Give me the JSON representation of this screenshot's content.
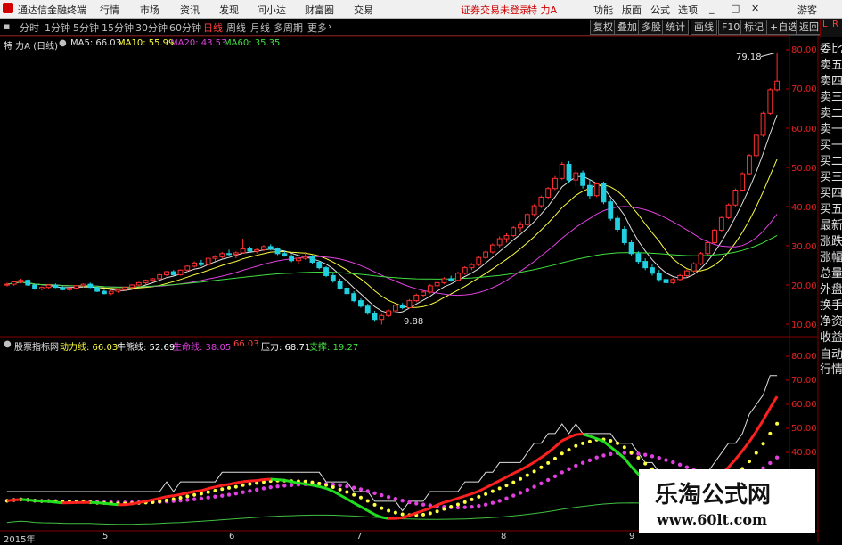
{
  "app": {
    "title": "通达信金融终端"
  },
  "menu": [
    "行情",
    "市场",
    "资讯",
    "发现",
    "问小达",
    "财富圈",
    "交易"
  ],
  "login_status": "证券交易未登录",
  "security_name": "特 力A",
  "right_menu": [
    "功能",
    "版面",
    "公式",
    "选项"
  ],
  "guest": "游客",
  "periods": [
    "分时",
    "1分钟",
    "5分钟",
    "15分钟",
    "30分钟",
    "60分钟",
    "日线",
    "周线",
    "月线",
    "多周期",
    "更多"
  ],
  "active_period": "日线",
  "toolbar_buttons": [
    "复权",
    "叠加",
    "多股",
    "统计",
    "画线",
    "F10",
    "标记",
    "+自选",
    "返回"
  ],
  "main_legend": {
    "title": "特 力A (日线)",
    "ma": [
      {
        "label": "MA5: 66.03",
        "color": "#e0e0e0"
      },
      {
        "label": "MA10: 55.99",
        "color": "#ffff40"
      },
      {
        "label": "MA20: 43.53",
        "color": "#e040e0"
      },
      {
        "label": "MA60: 35.35",
        "color": "#40e040"
      }
    ]
  },
  "indicator_legend": {
    "title": "股票指标网",
    "items": [
      {
        "label": "动力线: 66.03",
        "color": "#ffff40"
      },
      {
        "label": "牛熊线: 52.69",
        "color": "#ffffff"
      },
      {
        "label": "生命线: 38.05",
        "color": "#e040e0"
      },
      {
        "label": "66.03",
        "color": "#ff4040"
      },
      {
        "label": "压力: 68.71",
        "color": "#ffffff"
      },
      {
        "label": "支撑: 19.27",
        "color": "#40e040"
      }
    ]
  },
  "price_axis": [
    "80.00",
    "70.00",
    "60.00",
    "50.00",
    "40.00",
    "30.00",
    "20.00",
    "10.00"
  ],
  "ind_axis": [
    "80.00",
    "70.00",
    "60.00",
    "50.00",
    "40.00"
  ],
  "x_labels": [
    "2015年",
    "5",
    "6",
    "7",
    "8",
    "9"
  ],
  "annotations": {
    "high": "79.18",
    "low": "9.88"
  },
  "right_panel": [
    "委比",
    "卖五",
    "卖四",
    "卖三",
    "卖二",
    "卖一",
    "买一",
    "买二",
    "买三",
    "买四",
    "买五",
    "最新",
    "涨跌",
    "涨幅",
    "总量",
    "外盘",
    "换手",
    "净资",
    "收益"
  ],
  "right_panel_bottom": [
    "自动",
    "行情"
  ],
  "side_tab": {
    "top": "L",
    "mid": "R"
  },
  "watermark": {
    "title": "乐淘公式网",
    "url": "www.60lt.com"
  },
  "colors": {
    "up": "#ff3030",
    "down": "#20d0e0",
    "ma5": "#e0e0e0",
    "ma10": "#ffff40",
    "ma20": "#e040e0",
    "ma60": "#40e040"
  },
  "chart_data": {
    "type": "candlestick",
    "title": "特 力A (日线)",
    "ylim": [
      8,
      82
    ],
    "x_labels": [
      "2015年",
      "5",
      "6",
      "7",
      "8",
      "9"
    ],
    "ohlc": [
      [
        20.0,
        20.6,
        19.6,
        20.2
      ],
      [
        20.2,
        21.0,
        19.8,
        20.8
      ],
      [
        20.8,
        21.6,
        20.4,
        21.2
      ],
      [
        21.2,
        21.4,
        19.8,
        20.0
      ],
      [
        20.0,
        20.2,
        18.8,
        19.0
      ],
      [
        19.0,
        19.6,
        18.6,
        19.4
      ],
      [
        19.4,
        20.2,
        19.0,
        20.0
      ],
      [
        20.0,
        20.4,
        19.2,
        19.4
      ],
      [
        19.4,
        19.8,
        18.6,
        18.8
      ],
      [
        18.8,
        19.4,
        18.4,
        19.2
      ],
      [
        19.2,
        20.0,
        18.8,
        19.8
      ],
      [
        19.8,
        20.4,
        19.4,
        20.2
      ],
      [
        20.2,
        20.6,
        19.2,
        19.4
      ],
      [
        19.4,
        19.6,
        18.2,
        18.4
      ],
      [
        18.4,
        18.8,
        17.6,
        17.8
      ],
      [
        17.8,
        18.6,
        17.4,
        18.4
      ],
      [
        18.4,
        19.0,
        18.0,
        18.8
      ],
      [
        18.8,
        19.6,
        18.4,
        19.4
      ],
      [
        19.4,
        20.2,
        19.0,
        20.0
      ],
      [
        20.0,
        20.8,
        19.6,
        20.6
      ],
      [
        20.6,
        21.4,
        20.2,
        21.2
      ],
      [
        21.2,
        21.8,
        20.8,
        21.6
      ],
      [
        21.6,
        22.8,
        21.4,
        22.6
      ],
      [
        22.6,
        23.6,
        22.2,
        23.4
      ],
      [
        23.4,
        23.8,
        22.4,
        22.6
      ],
      [
        22.6,
        24.0,
        22.4,
        23.8
      ],
      [
        23.8,
        25.0,
        23.4,
        24.8
      ],
      [
        24.8,
        26.0,
        24.4,
        25.6
      ],
      [
        25.6,
        26.4,
        24.8,
        25.2
      ],
      [
        25.2,
        27.0,
        25.0,
        26.8
      ],
      [
        26.8,
        27.6,
        26.0,
        27.2
      ],
      [
        27.2,
        28.4,
        26.8,
        28.0
      ],
      [
        28.0,
        29.0,
        27.4,
        27.8
      ],
      [
        27.8,
        28.6,
        26.8,
        28.2
      ],
      [
        28.2,
        31.8,
        28.0,
        29.2
      ],
      [
        29.2,
        29.8,
        28.2,
        28.6
      ],
      [
        28.6,
        29.4,
        28.0,
        29.0
      ],
      [
        29.0,
        30.2,
        28.6,
        29.8
      ],
      [
        29.8,
        30.4,
        28.8,
        29.2
      ],
      [
        29.2,
        29.6,
        27.6,
        28.0
      ],
      [
        28.0,
        28.8,
        27.2,
        27.4
      ],
      [
        27.4,
        27.8,
        25.8,
        26.2
      ],
      [
        26.2,
        27.0,
        25.4,
        26.8
      ],
      [
        26.8,
        28.4,
        26.4,
        27.2
      ],
      [
        27.2,
        27.6,
        25.4,
        25.8
      ],
      [
        25.8,
        26.2,
        24.0,
        24.4
      ],
      [
        24.4,
        24.8,
        22.0,
        22.4
      ],
      [
        22.4,
        23.0,
        20.6,
        21.0
      ],
      [
        21.0,
        21.6,
        18.8,
        19.2
      ],
      [
        19.2,
        19.8,
        17.4,
        17.8
      ],
      [
        17.8,
        18.4,
        15.6,
        16.0
      ],
      [
        16.0,
        16.6,
        14.2,
        14.6
      ],
      [
        14.6,
        15.2,
        12.4,
        12.8
      ],
      [
        12.8,
        13.4,
        10.6,
        11.2
      ],
      [
        11.2,
        12.6,
        9.9,
        12.2
      ],
      [
        12.2,
        13.8,
        11.8,
        13.4
      ],
      [
        13.4,
        15.0,
        13.0,
        14.8
      ],
      [
        14.8,
        15.4,
        13.8,
        14.2
      ],
      [
        14.2,
        16.4,
        14.0,
        16.0
      ],
      [
        16.0,
        17.8,
        15.6,
        17.4
      ],
      [
        17.4,
        18.6,
        16.8,
        18.2
      ],
      [
        18.2,
        20.2,
        17.8,
        19.8
      ],
      [
        19.8,
        21.0,
        19.2,
        20.6
      ],
      [
        20.6,
        22.0,
        20.2,
        21.6
      ],
      [
        21.6,
        22.4,
        20.8,
        21.2
      ],
      [
        21.2,
        23.4,
        21.0,
        23.0
      ],
      [
        23.0,
        24.8,
        22.6,
        24.4
      ],
      [
        24.4,
        25.6,
        23.8,
        25.2
      ],
      [
        25.2,
        27.4,
        24.8,
        27.0
      ],
      [
        27.0,
        28.8,
        26.6,
        28.4
      ],
      [
        28.4,
        30.6,
        28.0,
        30.2
      ],
      [
        30.2,
        32.4,
        29.6,
        31.8
      ],
      [
        31.8,
        33.2,
        30.8,
        32.6
      ],
      [
        32.6,
        35.0,
        32.2,
        34.6
      ],
      [
        34.6,
        36.2,
        33.4,
        35.4
      ],
      [
        35.4,
        38.4,
        35.0,
        38.0
      ],
      [
        38.0,
        40.6,
        37.4,
        40.2
      ],
      [
        40.2,
        42.8,
        39.6,
        42.4
      ],
      [
        42.4,
        45.0,
        41.8,
        44.6
      ],
      [
        44.6,
        47.8,
        44.2,
        47.2
      ],
      [
        47.2,
        51.4,
        46.8,
        50.8
      ],
      [
        50.8,
        51.6,
        46.0,
        46.8
      ],
      [
        46.8,
        49.4,
        45.2,
        48.6
      ],
      [
        48.6,
        49.2,
        44.6,
        45.4
      ],
      [
        45.4,
        47.0,
        42.0,
        42.8
      ],
      [
        42.8,
        46.2,
        42.4,
        45.8
      ],
      [
        45.8,
        46.4,
        40.6,
        41.2
      ],
      [
        41.2,
        42.0,
        36.4,
        37.0
      ],
      [
        37.0,
        37.8,
        33.6,
        34.2
      ],
      [
        34.2,
        35.0,
        30.2,
        30.8
      ],
      [
        30.8,
        31.4,
        27.4,
        28.0
      ],
      [
        28.0,
        28.6,
        25.4,
        26.0
      ],
      [
        26.0,
        26.8,
        23.8,
        24.4
      ],
      [
        24.4,
        25.2,
        22.4,
        23.0
      ],
      [
        23.0,
        23.8,
        20.8,
        21.4
      ],
      [
        21.4,
        22.2,
        19.8,
        20.6
      ],
      [
        20.6,
        21.8,
        20.2,
        21.4
      ],
      [
        21.4,
        22.8,
        21.0,
        22.4
      ],
      [
        22.4,
        24.0,
        22.0,
        23.6
      ],
      [
        23.6,
        25.8,
        23.2,
        25.4
      ],
      [
        25.4,
        28.4,
        25.0,
        28.0
      ],
      [
        28.0,
        31.2,
        27.6,
        30.8
      ],
      [
        30.8,
        34.4,
        30.4,
        34.0
      ],
      [
        34.0,
        37.6,
        33.6,
        37.2
      ],
      [
        37.2,
        40.8,
        36.8,
        40.4
      ],
      [
        40.4,
        44.6,
        40.0,
        44.2
      ],
      [
        44.2,
        48.8,
        43.8,
        48.4
      ],
      [
        48.4,
        53.4,
        48.0,
        53.0
      ],
      [
        53.0,
        58.6,
        52.6,
        58.2
      ],
      [
        58.2,
        64.2,
        57.8,
        63.8
      ],
      [
        63.8,
        70.2,
        63.4,
        69.8
      ],
      [
        69.8,
        79.18,
        69.4,
        72.0
      ]
    ],
    "ma_series": [
      "MA5",
      "MA10",
      "MA20",
      "MA60"
    ],
    "high_mark": 79.18,
    "low_mark": 9.88
  }
}
